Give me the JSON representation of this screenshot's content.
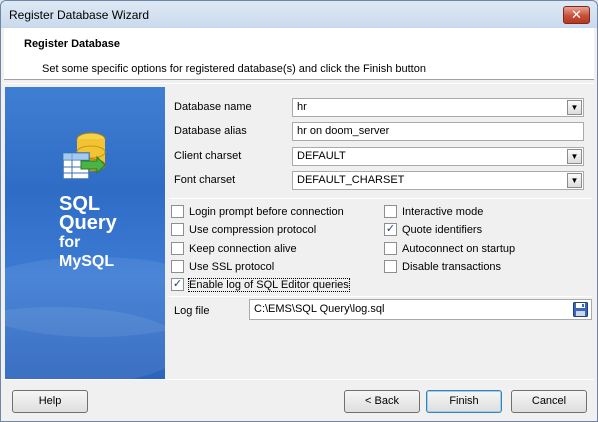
{
  "window": {
    "title": "Register Database Wizard",
    "close_glyph": "✕"
  },
  "header": {
    "title": "Register Database",
    "subtitle": "Set some specific options for registered database(s) and click the Finish button"
  },
  "side_panel": {
    "product_line1": "SQL",
    "product_line2": "Query",
    "product_line3": "for",
    "product_line4": "MySQL"
  },
  "form": {
    "database_name": {
      "label": "Database name",
      "value": "hr"
    },
    "database_alias": {
      "label": "Database alias",
      "value": "hr on doom_server"
    },
    "client_charset": {
      "label": "Client charset",
      "value": "DEFAULT"
    },
    "font_charset": {
      "label": "Font charset",
      "value": "DEFAULT_CHARSET"
    },
    "options_left": [
      {
        "label": "Login prompt before connection",
        "checked": false
      },
      {
        "label": "Use compression protocol",
        "checked": false
      },
      {
        "label": "Keep connection alive",
        "checked": false
      },
      {
        "label": "Use SSL protocol",
        "checked": false
      },
      {
        "label": "Enable log of SQL Editor queries",
        "checked": true
      }
    ],
    "options_right": [
      {
        "label": "Interactive mode",
        "checked": false
      },
      {
        "label": "Quote identifiers",
        "checked": true
      },
      {
        "label": "Autoconnect on startup",
        "checked": false
      },
      {
        "label": "Disable transactions",
        "checked": false
      }
    ],
    "log_file": {
      "label": "Log file",
      "value": "C:\\EMS\\SQL Query\\log.sql"
    }
  },
  "buttons": {
    "help": "Help",
    "back": "< Back",
    "finish": "Finish",
    "cancel": "Cancel"
  },
  "icons": {
    "dropdown": "chevron-down-icon",
    "save_dialog": "floppy-disk-icon",
    "logo": "database-table-icon"
  },
  "colors": {
    "side_panel": "#2f6cc6",
    "check_mark": "#1c3f7a"
  }
}
